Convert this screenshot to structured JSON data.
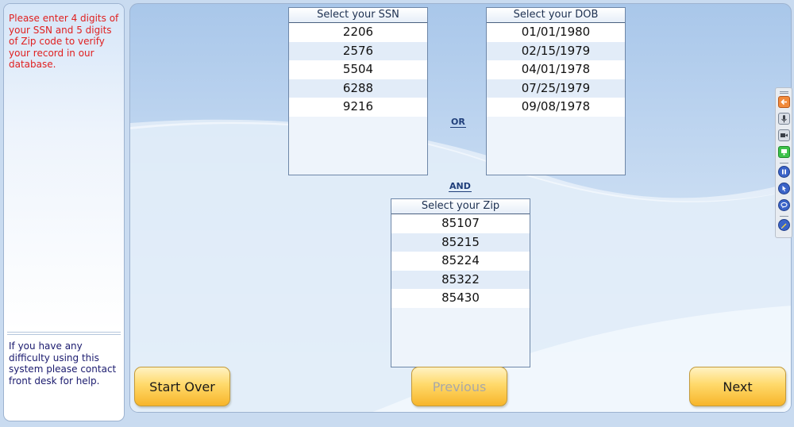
{
  "sidebar": {
    "instructions": "Please enter 4 digits of your SSN and 5 digits of Zip code to verify your record in our database.",
    "help": "If you have any difficulty using this system please contact front desk for help."
  },
  "ssn": {
    "header": "Select your SSN",
    "items": [
      "2206",
      "2576",
      "5504",
      "6288",
      "9216"
    ]
  },
  "dob": {
    "header": "Select your DOB",
    "items": [
      "01/01/1980",
      "02/15/1979",
      "04/01/1978",
      "07/25/1979",
      "09/08/1978"
    ]
  },
  "zip": {
    "header": "Select your Zip",
    "items": [
      "85107",
      "85215",
      "85224",
      "85322",
      "85430"
    ]
  },
  "labels": {
    "or": "OR",
    "and": "AND"
  },
  "buttons": {
    "start_over": "Start Over",
    "previous": "Previous",
    "next": "Next"
  },
  "toolbar": {
    "icons": [
      "back-arrow-icon",
      "microphone-icon",
      "camera-icon",
      "screen-icon",
      "pause-icon",
      "pointer-icon",
      "chat-icon",
      "pen-icon"
    ]
  },
  "colors": {
    "instructions_text": "#e02020",
    "help_text": "#1a1a6e",
    "button_gradient_top": "#fff2c2",
    "button_gradient_bottom": "#f7b52a",
    "conjunction_text": "#1f3e7a"
  }
}
